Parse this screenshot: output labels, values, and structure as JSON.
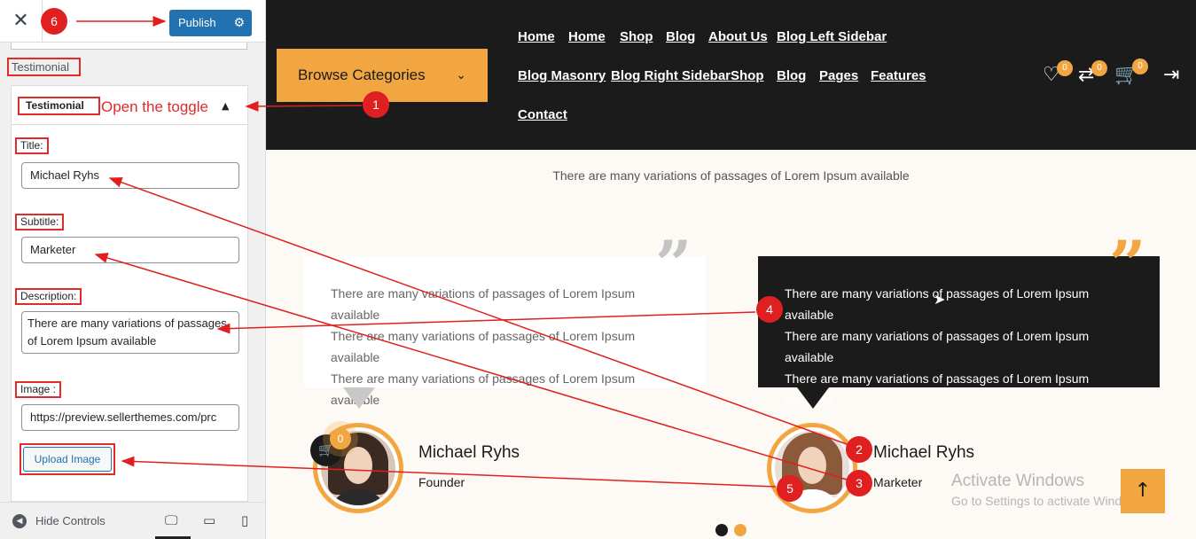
{
  "sidebar": {
    "close_icon": "close-icon",
    "publish_label": "Publish",
    "publish_gear_icon": "gear-icon",
    "section_title": "Testimonial",
    "toggle_label": "Testimonial",
    "toggle_hint": "Open the toggle",
    "fields": {
      "title_label": "Title:",
      "title_value": "Michael Ryhs",
      "subtitle_label": "Subtitle:",
      "subtitle_value": "Marketer",
      "description_label": "Description:",
      "description_value": "There are many variations of passages of Lorem Ipsum available",
      "image_label": "Image :",
      "image_value": "https://preview.sellerthemes.com/prc"
    },
    "upload_label": "Upload Image",
    "footer": {
      "hide_label": "Hide Controls"
    }
  },
  "preview": {
    "browse_label": "Browse Categories",
    "nav_row1": [
      "Home",
      "Home",
      "Shop",
      "Blog",
      "About Us",
      "Blog Left Sidebar"
    ],
    "nav_row2": [
      "Blog Masonry",
      "Blog Right Sidebar",
      "Shop",
      "Blog",
      "Pages",
      "Features"
    ],
    "nav_row3": [
      "Contact"
    ],
    "header_badges": [
      "0",
      "0",
      "0"
    ],
    "intro": "There are many variations of passages of Lorem Ipsum available",
    "testimonials": [
      {
        "lines": [
          "There are many variations of passages of Lorem Ipsum available",
          "There are many variations of passages of Lorem Ipsum available",
          "There are many variations of passages of Lorem Ipsum available"
        ],
        "name": "Michael Ryhs",
        "role": "Founder"
      },
      {
        "lines": [
          "There are many variations of passages of Lorem Ipsum available",
          "There are many variations of passages of Lorem Ipsum available",
          "There are many variations of passages of Lorem Ipsum available"
        ],
        "name": "Michael Ryhs",
        "role": "Marketer"
      }
    ],
    "float_badge": "0",
    "watermark_title": "Activate Windows",
    "watermark_sub": "Go to Settings to activate Windows.",
    "to_top_icon": "arrow-up-icon"
  },
  "annotations": {
    "markers": [
      "1",
      "2",
      "3",
      "4",
      "5",
      "6"
    ]
  },
  "colors": {
    "accent": "#f2a642",
    "dark": "#1b1b1b",
    "annotation_red": "#e02020",
    "publish_blue": "#2271b1"
  }
}
